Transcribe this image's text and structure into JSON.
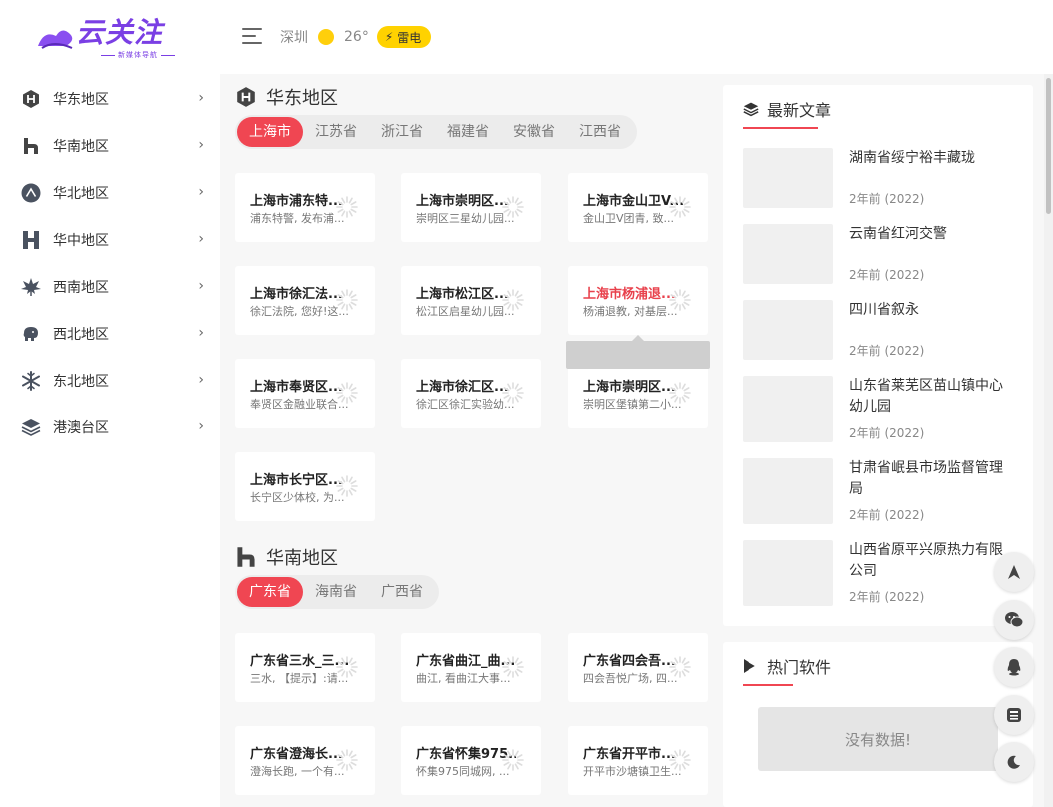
{
  "header": {
    "logo_text": "云关注",
    "logo_sub": "新媒体导航",
    "weather": {
      "city": "深圳",
      "temp": "26°",
      "condition": "雷电"
    }
  },
  "sidebar": {
    "items": [
      {
        "label": "华东地区",
        "icon": "hexagon-h-icon"
      },
      {
        "label": "华南地区",
        "icon": "house-h-icon"
      },
      {
        "label": "华北地区",
        "icon": "circle-a-icon"
      },
      {
        "label": "华中地区",
        "icon": "h-letter-icon"
      },
      {
        "label": "西南地区",
        "icon": "leaf-icon"
      },
      {
        "label": "西北地区",
        "icon": "elephant-icon"
      },
      {
        "label": "东北地区",
        "icon": "snowflake-icon"
      },
      {
        "label": "港澳台区",
        "icon": "layers-icon"
      }
    ]
  },
  "sections": [
    {
      "title": "华东地区",
      "tabs": [
        "上海市",
        "江苏省",
        "浙江省",
        "福建省",
        "安徽省",
        "江西省"
      ],
      "active_tab": 0,
      "cards": [
        {
          "title": "上海市浦东特...",
          "desc": "浦东特警, 发布浦..."
        },
        {
          "title": "上海市崇明区...",
          "desc": "崇明区三星幼儿园..."
        },
        {
          "title": "上海市金山卫V...",
          "desc": "金山卫V团青, 致..."
        },
        {
          "title": "上海市徐汇法...",
          "desc": "徐汇法院, 您好!这..."
        },
        {
          "title": "上海市松江区...",
          "desc": "松江区启星幼儿园..."
        },
        {
          "title": "上海市杨浦退...",
          "desc": "杨浦退教, 对基层..."
        },
        {
          "title": "上海市奉贤区...",
          "desc": "奉贤区金融业联合..."
        },
        {
          "title": "上海市徐汇区...",
          "desc": "徐汇区徐汇实验幼..."
        },
        {
          "title": "上海市崇明区...",
          "desc": "崇明区堡镇第二小..."
        },
        {
          "title": "上海市长宁区...",
          "desc": "长宁区少体校, 为..."
        }
      ]
    },
    {
      "title": "华南地区",
      "tabs": [
        "广东省",
        "海南省",
        "广西省"
      ],
      "active_tab": 0,
      "cards": [
        {
          "title": "广东省三水_三...",
          "desc": "三水, 【提示】:请..."
        },
        {
          "title": "广东省曲江_曲...",
          "desc": "曲江, 看曲江大事..."
        },
        {
          "title": "广东省四会吾...",
          "desc": "四会吾悦广场, 四..."
        },
        {
          "title": "广东省澄海长...",
          "desc": "澄海长跑, 一个有..."
        },
        {
          "title": "广东省怀集975...",
          "desc": "怀集975同城网, ..."
        },
        {
          "title": "广东省开平市...",
          "desc": "开平市沙塘镇卫生..."
        }
      ]
    }
  ],
  "latest": {
    "title": "最新文章",
    "articles": [
      {
        "title": "湖南省绥宁裕丰藏珑",
        "date": "2年前 (2022)"
      },
      {
        "title": "云南省红河交警",
        "date": "2年前 (2022)"
      },
      {
        "title": "四川省叙永",
        "date": "2年前 (2022)"
      },
      {
        "title": "山东省莱芜区苗山镇中心幼儿园",
        "date": "2年前 (2022)"
      },
      {
        "title": "甘肃省岷县市场监督管理局",
        "date": "2年前 (2022)"
      },
      {
        "title": "山西省原平兴原热力有限公司",
        "date": "2年前 (2022)"
      }
    ]
  },
  "hot": {
    "title": "热门软件",
    "empty": "没有数据!"
  },
  "float_buttons": [
    "navigate-icon",
    "wechat-icon",
    "qq-icon",
    "calculator-icon",
    "moon-icon"
  ],
  "colors": {
    "accent": "#f04652",
    "brand": "#7a3fe4",
    "sun": "#ffcf0b",
    "badge": "#ffd200"
  }
}
